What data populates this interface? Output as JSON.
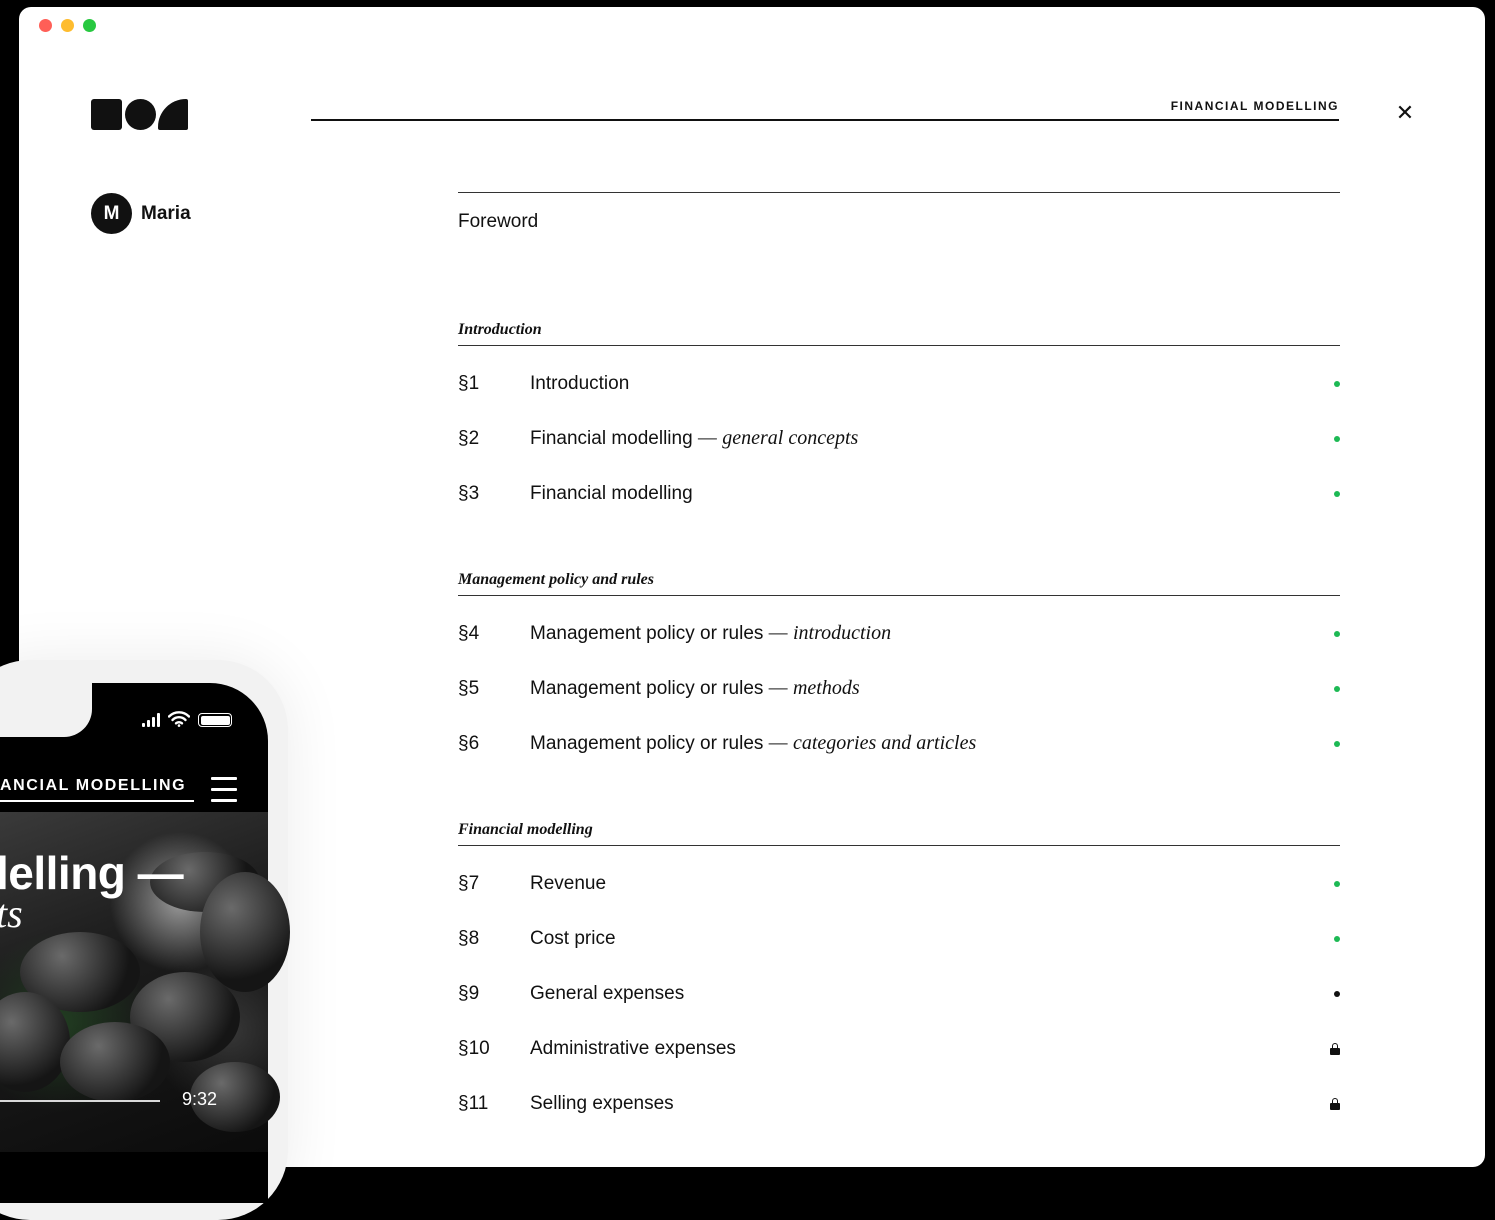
{
  "window": {
    "traffic_lights": [
      "#ff5f57",
      "#febc2e",
      "#28c840"
    ]
  },
  "header": {
    "section_title": "FINANCIAL MODELLING",
    "close_icon": "close-icon"
  },
  "user": {
    "initial": "M",
    "name": "Maria"
  },
  "toc": {
    "foreword": "Foreword",
    "groups": [
      {
        "title": "Introduction",
        "items": [
          {
            "num": "§1",
            "title": "Introduction",
            "subtitle": "",
            "status": "complete"
          },
          {
            "num": "§2",
            "title": "Financial modelling",
            "subtitle": "general concepts",
            "status": "complete"
          },
          {
            "num": "§3",
            "title": "Financial modelling",
            "subtitle": "",
            "status": "complete"
          }
        ]
      },
      {
        "title": "Management policy and rules",
        "items": [
          {
            "num": "§4",
            "title": "Management policy or rules",
            "subtitle": "introduction",
            "status": "complete"
          },
          {
            "num": "§5",
            "title": "Management policy or rules",
            "subtitle": "methods",
            "status": "complete"
          },
          {
            "num": "§6",
            "title": "Management policy or rules",
            "subtitle": "categories and articles",
            "status": "complete"
          }
        ]
      },
      {
        "title": "Financial modelling",
        "items": [
          {
            "num": "§7",
            "title": "Revenue",
            "subtitle": "",
            "status": "complete"
          },
          {
            "num": "§8",
            "title": "Cost price",
            "subtitle": "",
            "status": "complete"
          },
          {
            "num": "§9",
            "title": "General expenses",
            "subtitle": "",
            "status": "current"
          },
          {
            "num": "§10",
            "title": "Administrative expenses",
            "subtitle": "",
            "status": "locked"
          },
          {
            "num": "§11",
            "title": "Selling expenses",
            "subtitle": "",
            "status": "locked"
          }
        ]
      }
    ],
    "status_colors": {
      "complete": "#1db954",
      "current": "#111111"
    }
  },
  "phone": {
    "header": "ANCIAL MODELLING",
    "headline": "lelling —",
    "subline": "ts",
    "time": "9:32"
  }
}
